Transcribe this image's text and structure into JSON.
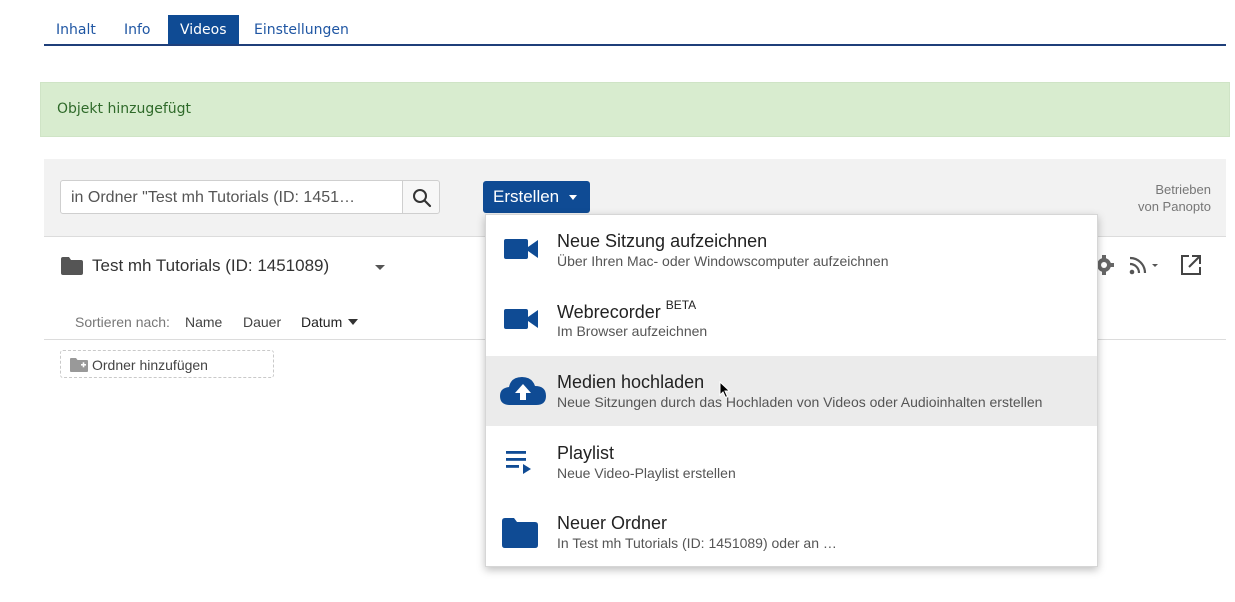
{
  "tabs": [
    {
      "label": "Inhalt",
      "active": false
    },
    {
      "label": "Info",
      "active": false
    },
    {
      "label": "Videos",
      "active": true
    },
    {
      "label": "Einstellungen",
      "active": false
    }
  ],
  "message": {
    "text": "Objekt hinzugefügt",
    "color": "#2f6a2a",
    "background": "#d8eccf"
  },
  "toolbar": {
    "search_value": "in Ordner \"Test mh Tutorials (ID: 1451…",
    "create_label": "Erstellen",
    "powered_line1": "Betrieben",
    "powered_line2": "von Panopto"
  },
  "folder": {
    "title": "Test mh Tutorials (ID: 1451089)"
  },
  "sort": {
    "label": "Sortieren nach:",
    "options": [
      "Name",
      "Dauer",
      "Datum"
    ],
    "active": "Datum"
  },
  "add_folder_label": "Ordner hinzufügen",
  "menu": {
    "items": [
      {
        "icon": "video-camera-icon",
        "title": "Neue Sitzung aufzeichnen",
        "badge": "",
        "subtitle": "Über Ihren Mac- oder Windowscomputer aufzeichnen"
      },
      {
        "icon": "video-camera-icon",
        "title": "Webrecorder",
        "badge": "BETA",
        "subtitle": "Im Browser aufzeichnen"
      },
      {
        "icon": "cloud-upload-icon",
        "title": "Medien hochladen",
        "badge": "",
        "subtitle": "Neue Sitzungen durch das Hochladen von Videos oder Audioinhalten erstellen"
      },
      {
        "icon": "playlist-icon",
        "title": "Playlist",
        "badge": "",
        "subtitle": "Neue Video-Playlist erstellen"
      },
      {
        "icon": "folder-icon",
        "title": "Neuer Ordner",
        "badge": "",
        "subtitle": "In Test mh Tutorials (ID: 1451089) oder an …"
      }
    ],
    "hovered_index": 2
  },
  "colors": {
    "accent": "#0f4b94",
    "link": "#1f56a3"
  }
}
